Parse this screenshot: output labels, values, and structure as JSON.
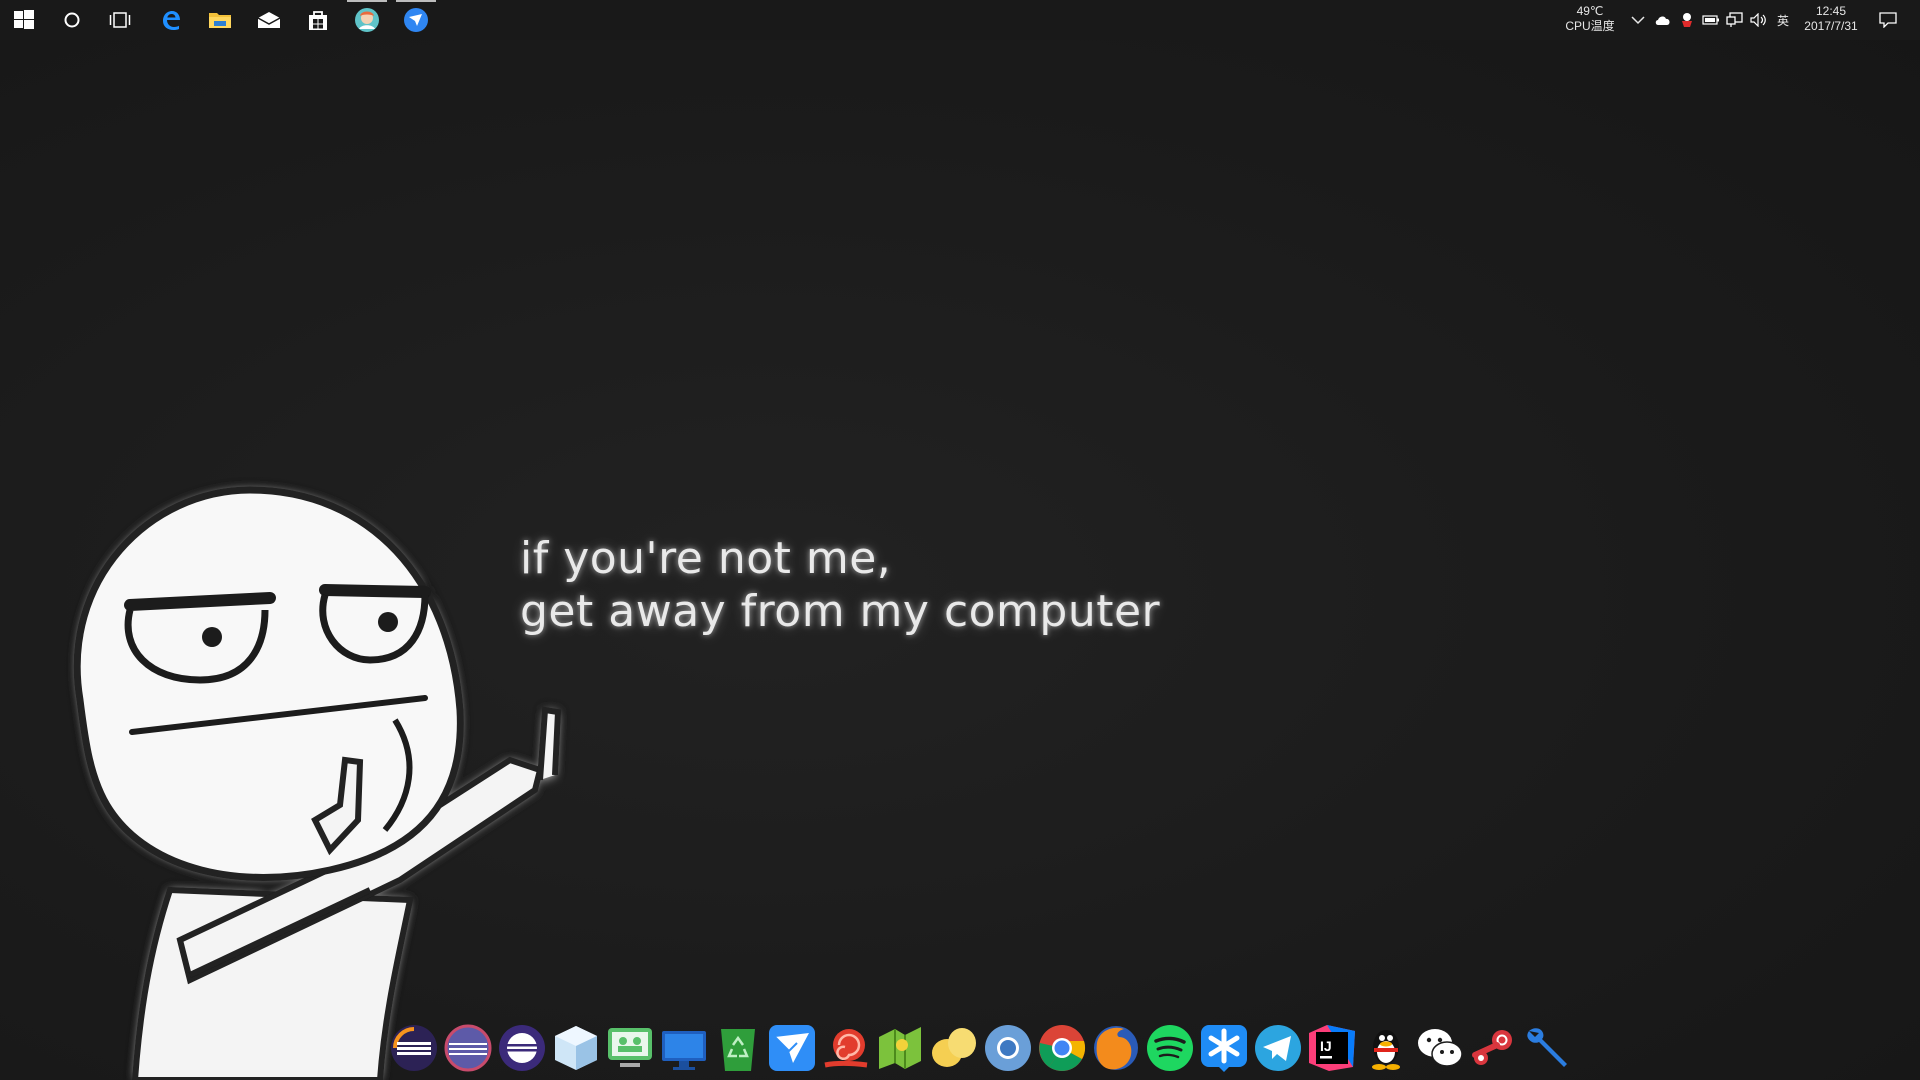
{
  "wallpaper": {
    "line1": "if you're not me,",
    "line2": "get away from my computer"
  },
  "taskbar": {
    "pinned": [
      {
        "name": "start-button",
        "icon": "windows-logo-icon"
      },
      {
        "name": "cortana-search-button",
        "icon": "cortana-circle-icon"
      },
      {
        "name": "task-view-button",
        "icon": "task-view-icon"
      },
      {
        "name": "edge-button",
        "icon": "edge-icon"
      },
      {
        "name": "file-explorer-button",
        "icon": "folder-icon"
      },
      {
        "name": "mail-button",
        "icon": "mail-icon"
      },
      {
        "name": "store-button",
        "icon": "store-icon"
      },
      {
        "name": "app-avatar-button",
        "icon": "avatar-app-icon"
      },
      {
        "name": "app-bird-button",
        "icon": "blue-bird-icon"
      }
    ],
    "tray": {
      "cpu_temp_value": "49℃",
      "cpu_temp_label": "CPU温度",
      "ime_label": "英",
      "time": "12:45",
      "date": "2017/7/31"
    }
  },
  "dock": {
    "apps": [
      "eclipse-icon",
      "eclipse-alt-icon",
      "eclipse-purple-icon",
      "virtual-box-icon",
      "remote-desktop-icon",
      "monitor-icon",
      "recycle-bin-icon",
      "feishu-bird-icon",
      "snail-icon",
      "map-app-icon",
      "yellow-blob-icon",
      "chromium-icon",
      "chrome-icon",
      "firefox-icon",
      "spotify-icon",
      "asterisk-app-icon",
      "telegram-icon",
      "intellij-icon",
      "qq-penguin-icon",
      "wechat-icon",
      "steam-icon",
      "wrench-tools-icon"
    ]
  },
  "colors": {
    "background": "#1c1c1c",
    "taskbar": "#191919",
    "accent_blue": "#2d8cf0"
  }
}
